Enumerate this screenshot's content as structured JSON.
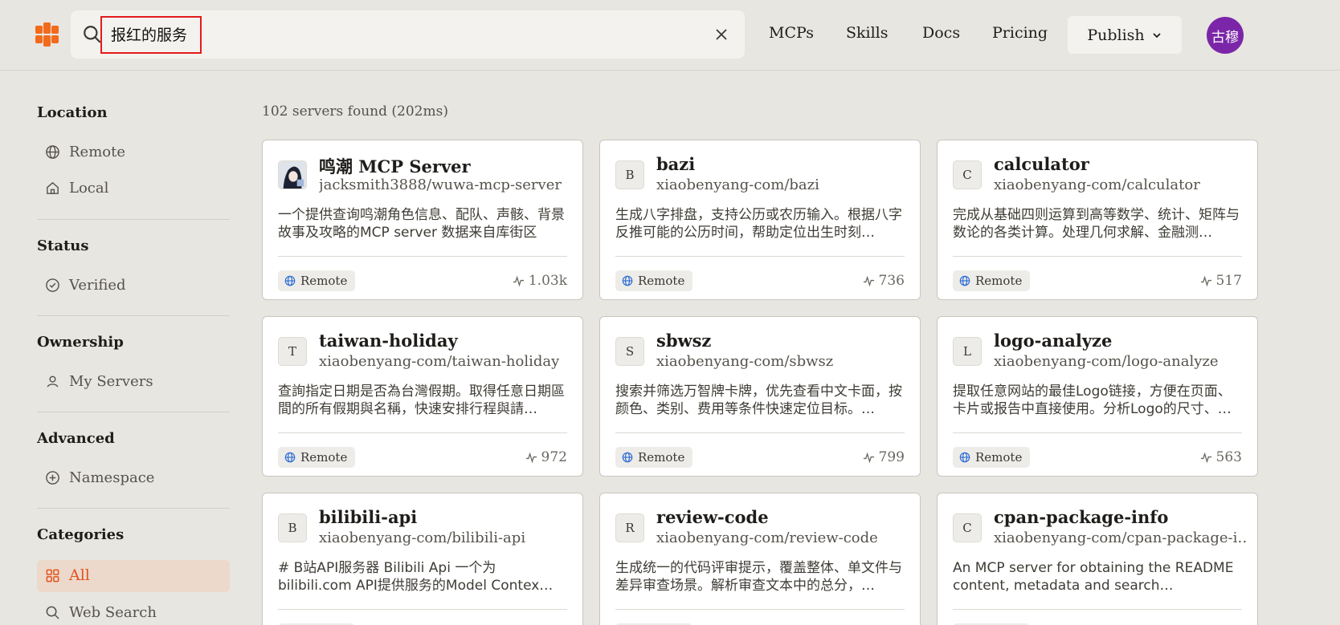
{
  "header": {
    "search": {
      "value": "报红的服务"
    },
    "nav": [
      "MCPs",
      "Skills",
      "Docs",
      "Pricing"
    ],
    "publish_label": "Publish",
    "avatar_text": "古穆",
    "colors": {
      "brand": "#f26a1b",
      "avatar": "#7b26a8"
    }
  },
  "sidebar": {
    "location": {
      "title": "Location",
      "items": [
        "Remote",
        "Local"
      ]
    },
    "status": {
      "title": "Status",
      "items": [
        "Verified"
      ]
    },
    "ownership": {
      "title": "Ownership",
      "items": [
        "My Servers"
      ]
    },
    "advanced": {
      "title": "Advanced",
      "items": [
        "Namespace"
      ]
    },
    "categories": {
      "title": "Categories",
      "items": [
        "All",
        "Web Search"
      ],
      "active": "All"
    }
  },
  "results": {
    "summary": "102 servers found (202ms)",
    "cards": [
      {
        "icon": "avatar-image",
        "name": "鸣潮 MCP Server",
        "path": "jacksmith3888/wuwa-mcp-server",
        "desc": "一个提供查询鸣潮角色信息、配队、声骸、背景故事及攻略的MCP server 数据来自库街区",
        "badge": "Remote",
        "stat": "1.03k"
      },
      {
        "icon": "B",
        "name": "bazi",
        "path": "xiaobenyang-com/bazi",
        "desc": "生成八字排盘，支持公历或农历输入。根据八字反推可能的公历时间，帮助定位出生时刻…",
        "badge": "Remote",
        "stat": "736"
      },
      {
        "icon": "C",
        "name": "calculator",
        "path": "xiaobenyang-com/calculator",
        "desc": "完成从基础四则运算到高等数学、统计、矩阵与数论的各类计算。处理几何求解、金融测…",
        "badge": "Remote",
        "stat": "517"
      },
      {
        "icon": "T",
        "name": "taiwan-holiday",
        "path": "xiaobenyang-com/taiwan-holiday",
        "desc": "查詢指定日期是否為台灣假期。取得任意日期區間的所有假期與名稱，快速安排行程與請…",
        "badge": "Remote",
        "stat": "972"
      },
      {
        "icon": "S",
        "name": "sbwsz",
        "path": "xiaobenyang-com/sbwsz",
        "desc": "搜索并筛选万智牌卡牌，优先查看中文卡面，按颜色、类别、费用等条件快速定位目标。…",
        "badge": "Remote",
        "stat": "799"
      },
      {
        "icon": "L",
        "name": "logo-analyze",
        "path": "xiaobenyang-com/logo-analyze",
        "desc": "提取任意网站的最佳Logo链接，方便在页面、卡片或报告中直接使用。分析Logo的尺寸、…",
        "badge": "Remote",
        "stat": "563"
      },
      {
        "icon": "B",
        "name": "bilibili-api",
        "path": "xiaobenyang-com/bilibili-api",
        "desc": "# B站API服务器 Bilibili Api 一个为bilibili.com API提供服务的Model Contex…",
        "badge": "Remote",
        "stat": ""
      },
      {
        "icon": "R",
        "name": "review-code",
        "path": "xiaobenyang-com/review-code",
        "desc": "生成统一的代码评审提示，覆盖整体、单文件与差异审查场景。解析审查文本中的总分，…",
        "badge": "Remote",
        "stat": ""
      },
      {
        "icon": "C",
        "name": "cpan-package-info",
        "path": "xiaobenyang-com/cpan-package-i…",
        "desc": "An MCP server for obtaining the README content, metadata and search…",
        "badge": "Remote",
        "stat": ""
      }
    ]
  }
}
